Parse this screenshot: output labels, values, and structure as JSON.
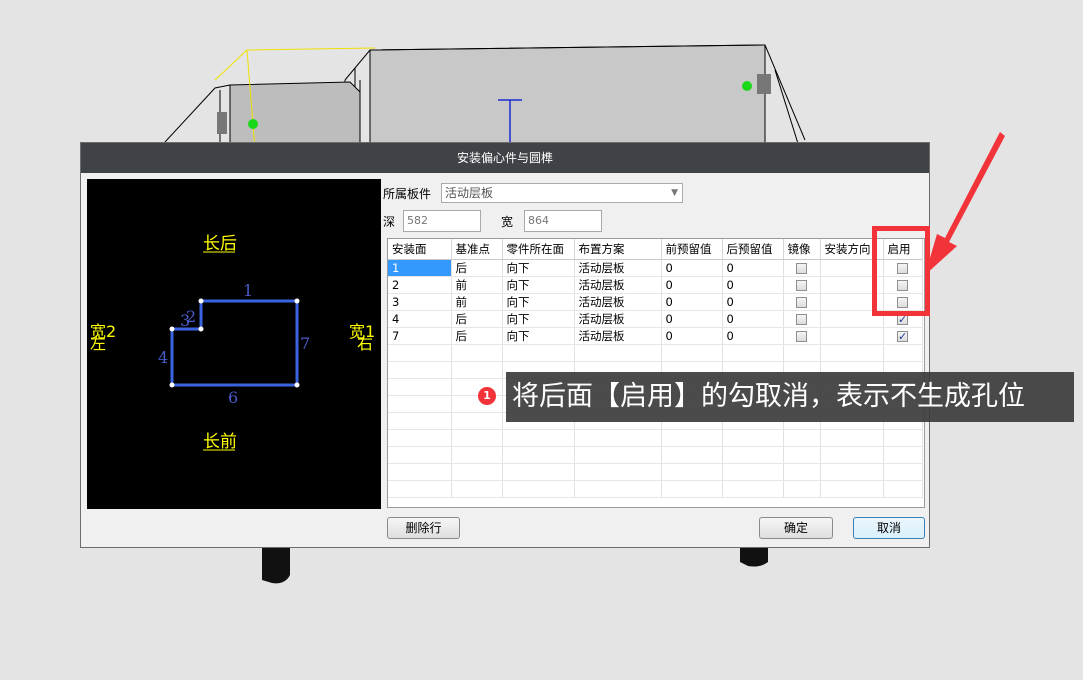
{
  "dialog": {
    "title": "安装偏心件与圆榫",
    "board_label": "所属板件",
    "board_value": "活动层板",
    "depth_label": "深",
    "depth_value": "582",
    "width_label": "宽",
    "width_value": "864",
    "delete_row": "删除行",
    "ok": "确定",
    "cancel": "取消"
  },
  "preview": {
    "top_label": "长后",
    "bottom_label": "长前",
    "left_label_1": "宽2",
    "left_label_2": "左",
    "right_label_1": "宽1",
    "right_label_2": "右",
    "edge_labels": [
      "1",
      "2",
      "3",
      "4",
      "6",
      "7"
    ],
    "colors": {
      "label": "#ffff00",
      "outline": "#3a63e0",
      "edge_number": "#4a5bc8"
    }
  },
  "table": {
    "columns": [
      "安装面",
      "基准点",
      "零件所在面",
      "布置方案",
      "前预留值",
      "后预留值",
      "镜像",
      "安装方向",
      "启用"
    ],
    "rows": [
      {
        "face": "1",
        "ref": "后",
        "side": "向下",
        "plan": "活动层板",
        "front": "0",
        "back": "0",
        "mirror": false,
        "dir": "",
        "enabled": false
      },
      {
        "face": "2",
        "ref": "前",
        "side": "向下",
        "plan": "活动层板",
        "front": "0",
        "back": "0",
        "mirror": false,
        "dir": "",
        "enabled": false
      },
      {
        "face": "3",
        "ref": "前",
        "side": "向下",
        "plan": "活动层板",
        "front": "0",
        "back": "0",
        "mirror": false,
        "dir": "",
        "enabled": false
      },
      {
        "face": "4",
        "ref": "后",
        "side": "向下",
        "plan": "活动层板",
        "front": "0",
        "back": "0",
        "mirror": false,
        "dir": "",
        "enabled": true
      },
      {
        "face": "7",
        "ref": "后",
        "side": "向下",
        "plan": "活动层板",
        "front": "0",
        "back": "0",
        "mirror": false,
        "dir": "",
        "enabled": true
      }
    ]
  },
  "annotation": {
    "badge": "1",
    "text": "将后面【启用】的勾取消，表示不生成孔位",
    "color": "#f2333a"
  }
}
